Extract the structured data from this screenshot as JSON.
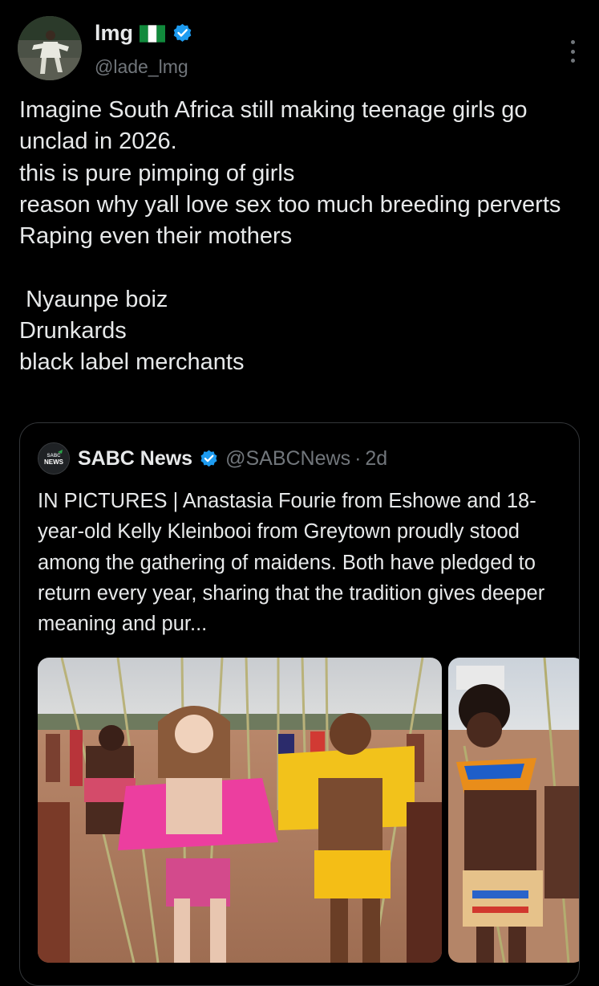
{
  "author": {
    "display_name": "lmg",
    "flag_icon": "nigeria-flag-icon",
    "verified_icon": "verified-badge-icon",
    "handle": "@lade_lmg"
  },
  "tweet": {
    "text": "Imagine South Africa still making teenage girls go unclad in 2026.\nthis is pure pimping of girls\nreason why yall love sex too much breeding perverts\nRaping even their mothers\n\n Nyaunpe boiz\nDrunkards\nblack label merchants"
  },
  "quoted": {
    "name": "SABC News",
    "logo_text": "SABC NEWS",
    "handle": "@SABCNews",
    "separator": "·",
    "time": "2d",
    "text": "IN PICTURES | Anastasia Fourie from Eshowe and 18-year-old Kelly Kleinbooi from Greytown proudly stood among the gathering of maidens. Both have pledged to return every year, sharing that the tradition gives deeper meaning and pur..."
  },
  "colors": {
    "background": "#000000",
    "text": "#e7e9ea",
    "muted": "#71767b",
    "verified": "#1d9bf0",
    "border": "#333639"
  }
}
